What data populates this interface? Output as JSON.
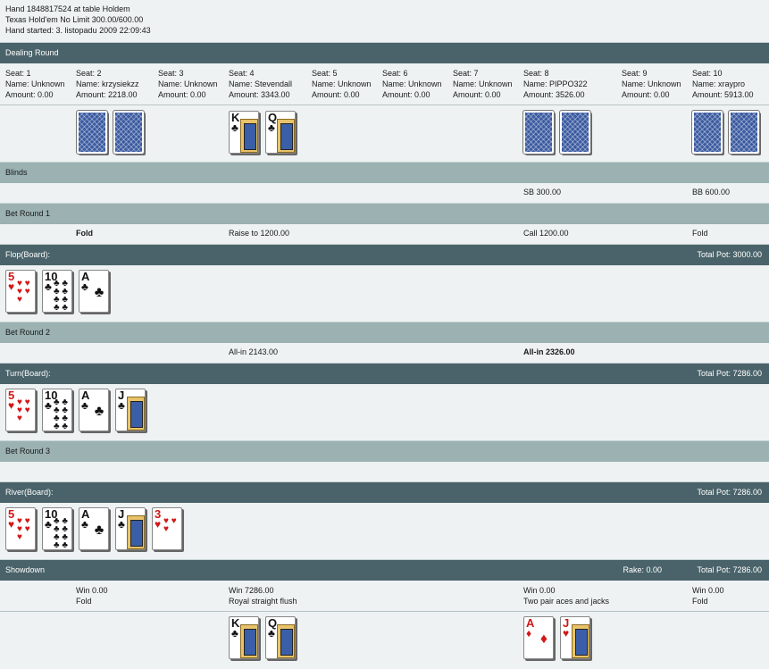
{
  "header": {
    "line1": "Hand 1848817524 at table Holdem",
    "line2": "Texas Hold'em No Limit 300.00/600.00",
    "line3": "Hand started: 3. listopadu 2009 22:09:43"
  },
  "sections": {
    "dealing": "Dealing Round",
    "blinds": "Blinds",
    "bet1": "Bet Round 1",
    "flop": "Flop(Board):",
    "flop_pot": "Total Pot: 3000.00",
    "bet2": "Bet Round 2",
    "turn": "Turn(Board):",
    "turn_pot": "Total Pot: 7286.00",
    "bet3": "Bet Round 3",
    "river": "River(Board):",
    "river_pot": "Total Pot: 7286.00",
    "showdown": "Showdown",
    "rake": "Rake: 0.00",
    "showdown_pot": "Total Pot: 7286.00"
  },
  "seats": [
    {
      "seat": "Seat: 1",
      "name": "Name: Unknown",
      "amount": "Amount: 0.00"
    },
    {
      "seat": "Seat: 2",
      "name": "Name: krzysiekzz",
      "amount": "Amount: 2218.00"
    },
    {
      "seat": "Seat: 3",
      "name": "Name: Unknown",
      "amount": "Amount: 0.00"
    },
    {
      "seat": "Seat: 4",
      "name": "Name: Stevendall",
      "amount": "Amount: 3343.00"
    },
    {
      "seat": "Seat: 5",
      "name": "Name: Unknown",
      "amount": "Amount: 0.00"
    },
    {
      "seat": "Seat: 6",
      "name": "Name: Unknown",
      "amount": "Amount: 0.00"
    },
    {
      "seat": "Seat: 7",
      "name": "Name: Unknown",
      "amount": "Amount: 0.00"
    },
    {
      "seat": "Seat: 8",
      "name": "Name: PIPPO322",
      "amount": "Amount: 3526.00"
    },
    {
      "seat": "Seat: 9",
      "name": "Name: Unknown",
      "amount": "Amount: 0.00"
    },
    {
      "seat": "Seat: 10",
      "name": "Name: xraypro",
      "amount": "Amount: 5913.00"
    }
  ],
  "blinds": {
    "sb": "SB 300.00",
    "bb": "BB 600.00"
  },
  "bet1": {
    "seat2": "Fold",
    "seat4": "Raise to 1200.00",
    "seat8": "Call 1200.00",
    "seat10": "Fold"
  },
  "bet2": {
    "seat4": "All-in 2143.00",
    "seat8": "All-in 2326.00"
  },
  "showdown": {
    "seat2_win": "Win 0.00",
    "seat2_hand": "Fold",
    "seat4_win": "Win 7286.00",
    "seat4_hand": "Royal straight flush",
    "seat8_win": "Win 0.00",
    "seat8_hand": "Two pair aces and jacks",
    "seat10_win": "Win 0.00",
    "seat10_hand": "Fold"
  },
  "cards": {
    "seat4_hole": [
      {
        "rank": "K",
        "suit": "♣"
      },
      {
        "rank": "Q",
        "suit": "♣"
      }
    ],
    "flop": [
      {
        "rank": "5",
        "suit": "♥"
      },
      {
        "rank": "10",
        "suit": "♣"
      },
      {
        "rank": "A",
        "suit": "♣"
      }
    ],
    "turn": [
      {
        "rank": "5",
        "suit": "♥"
      },
      {
        "rank": "10",
        "suit": "♣"
      },
      {
        "rank": "A",
        "suit": "♣"
      },
      {
        "rank": "J",
        "suit": "♣"
      }
    ],
    "river": [
      {
        "rank": "5",
        "suit": "♥"
      },
      {
        "rank": "10",
        "suit": "♣"
      },
      {
        "rank": "A",
        "suit": "♣"
      },
      {
        "rank": "J",
        "suit": "♣"
      },
      {
        "rank": "3",
        "suit": "♥"
      }
    ],
    "showdown_seat4": [
      {
        "rank": "K",
        "suit": "♣"
      },
      {
        "rank": "Q",
        "suit": "♣"
      }
    ],
    "showdown_seat8": [
      {
        "rank": "A",
        "suit": "♦"
      },
      {
        "rank": "J",
        "suit": "♥"
      }
    ]
  },
  "colors": {
    "dark_bar": "#4a636a",
    "light_bar": "#9bb1b2",
    "background": "#eef2f2",
    "red_suit": "#d01818"
  }
}
